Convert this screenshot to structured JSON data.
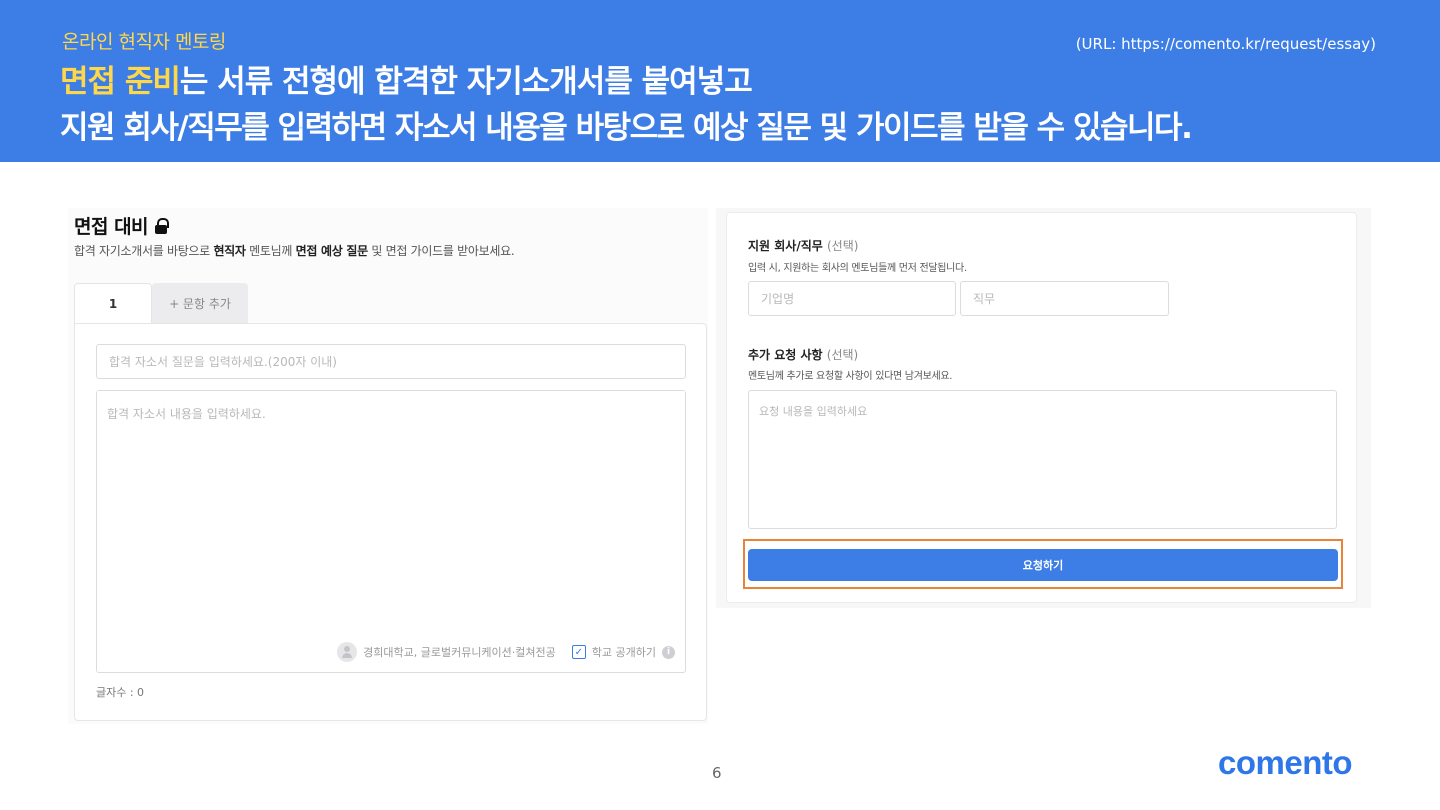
{
  "banner": {
    "subtitle": "온라인 현직자 멘토링",
    "url": "(URL: https://comento.kr/request/essay)",
    "headline_highlight": "면접 준비",
    "headline_rest": "는 서류 전형에 합격한 자기소개서를 붙여넣고",
    "headline_line2": "지원 회사/직무를 입력하면 자소서 내용을 바탕으로 예상 질문 및 가이드를 받을 수 있습니다."
  },
  "left": {
    "title": "면접 대비",
    "desc_1": "합격 자기소개서를 바탕으로 ",
    "desc_2": "현직자",
    "desc_3": " 멘토님께 ",
    "desc_4": "면접 예상 질문",
    "desc_5": " 및 면접 가이드를 받아보세요.",
    "tabs": [
      {
        "label": "1"
      },
      {
        "label": "+ 문항 추가"
      }
    ],
    "question_placeholder": "합격 자소서 질문을 입력하세요.(200자 이내)",
    "answer_placeholder": "합격 자소서 내용을 입력하세요.",
    "school": "경희대학교, 글로벌커뮤니케이션·컬쳐전공",
    "public_label": "학교 공개하기",
    "char_count": "글자수 : 0"
  },
  "right": {
    "company_label": "지원 회사/직무",
    "company_optional": "(선택)",
    "company_help": "입력 시, 지원하는 회사의 멘토님들께 먼저 전달됩니다.",
    "company_placeholder": "기업명",
    "job_placeholder": "직무",
    "request_label": "추가 요청 사항",
    "request_optional": "(선택)",
    "request_help": "멘토님께 추가로 요청할 사항이 있다면 남겨보세요.",
    "request_placeholder": "요청 내용을 입력하세요",
    "submit_label": "요청하기"
  },
  "footer": {
    "page_number": "6",
    "logo": "comento"
  }
}
